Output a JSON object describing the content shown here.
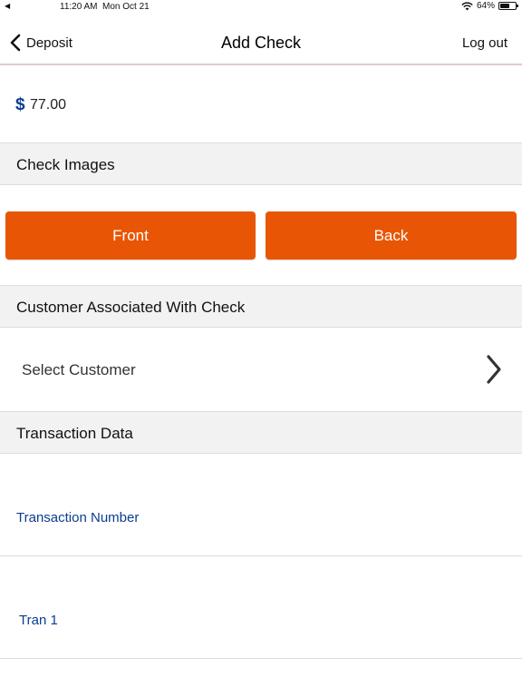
{
  "status_bar": {
    "back_indicator": "◀",
    "time": "11:20 AM",
    "date": "Mon Oct 21",
    "battery_percent": "64%",
    "battery_level": 0.64
  },
  "nav": {
    "back_label": "Deposit",
    "title": "Add Check",
    "logout_label": "Log out"
  },
  "amount": {
    "currency_symbol": "$",
    "value": "77.00"
  },
  "sections": {
    "check_images": "Check Images",
    "customer": "Customer Associated With Check",
    "transaction": "Transaction Data"
  },
  "buttons": {
    "front": "Front",
    "back": "Back"
  },
  "customer": {
    "select_label": "Select Customer"
  },
  "transaction_fields": {
    "number_label": "Transaction Number",
    "tran_value": "Tran 1"
  },
  "colors": {
    "accent_orange": "#e85605",
    "link_blue": "#0b3d91"
  }
}
